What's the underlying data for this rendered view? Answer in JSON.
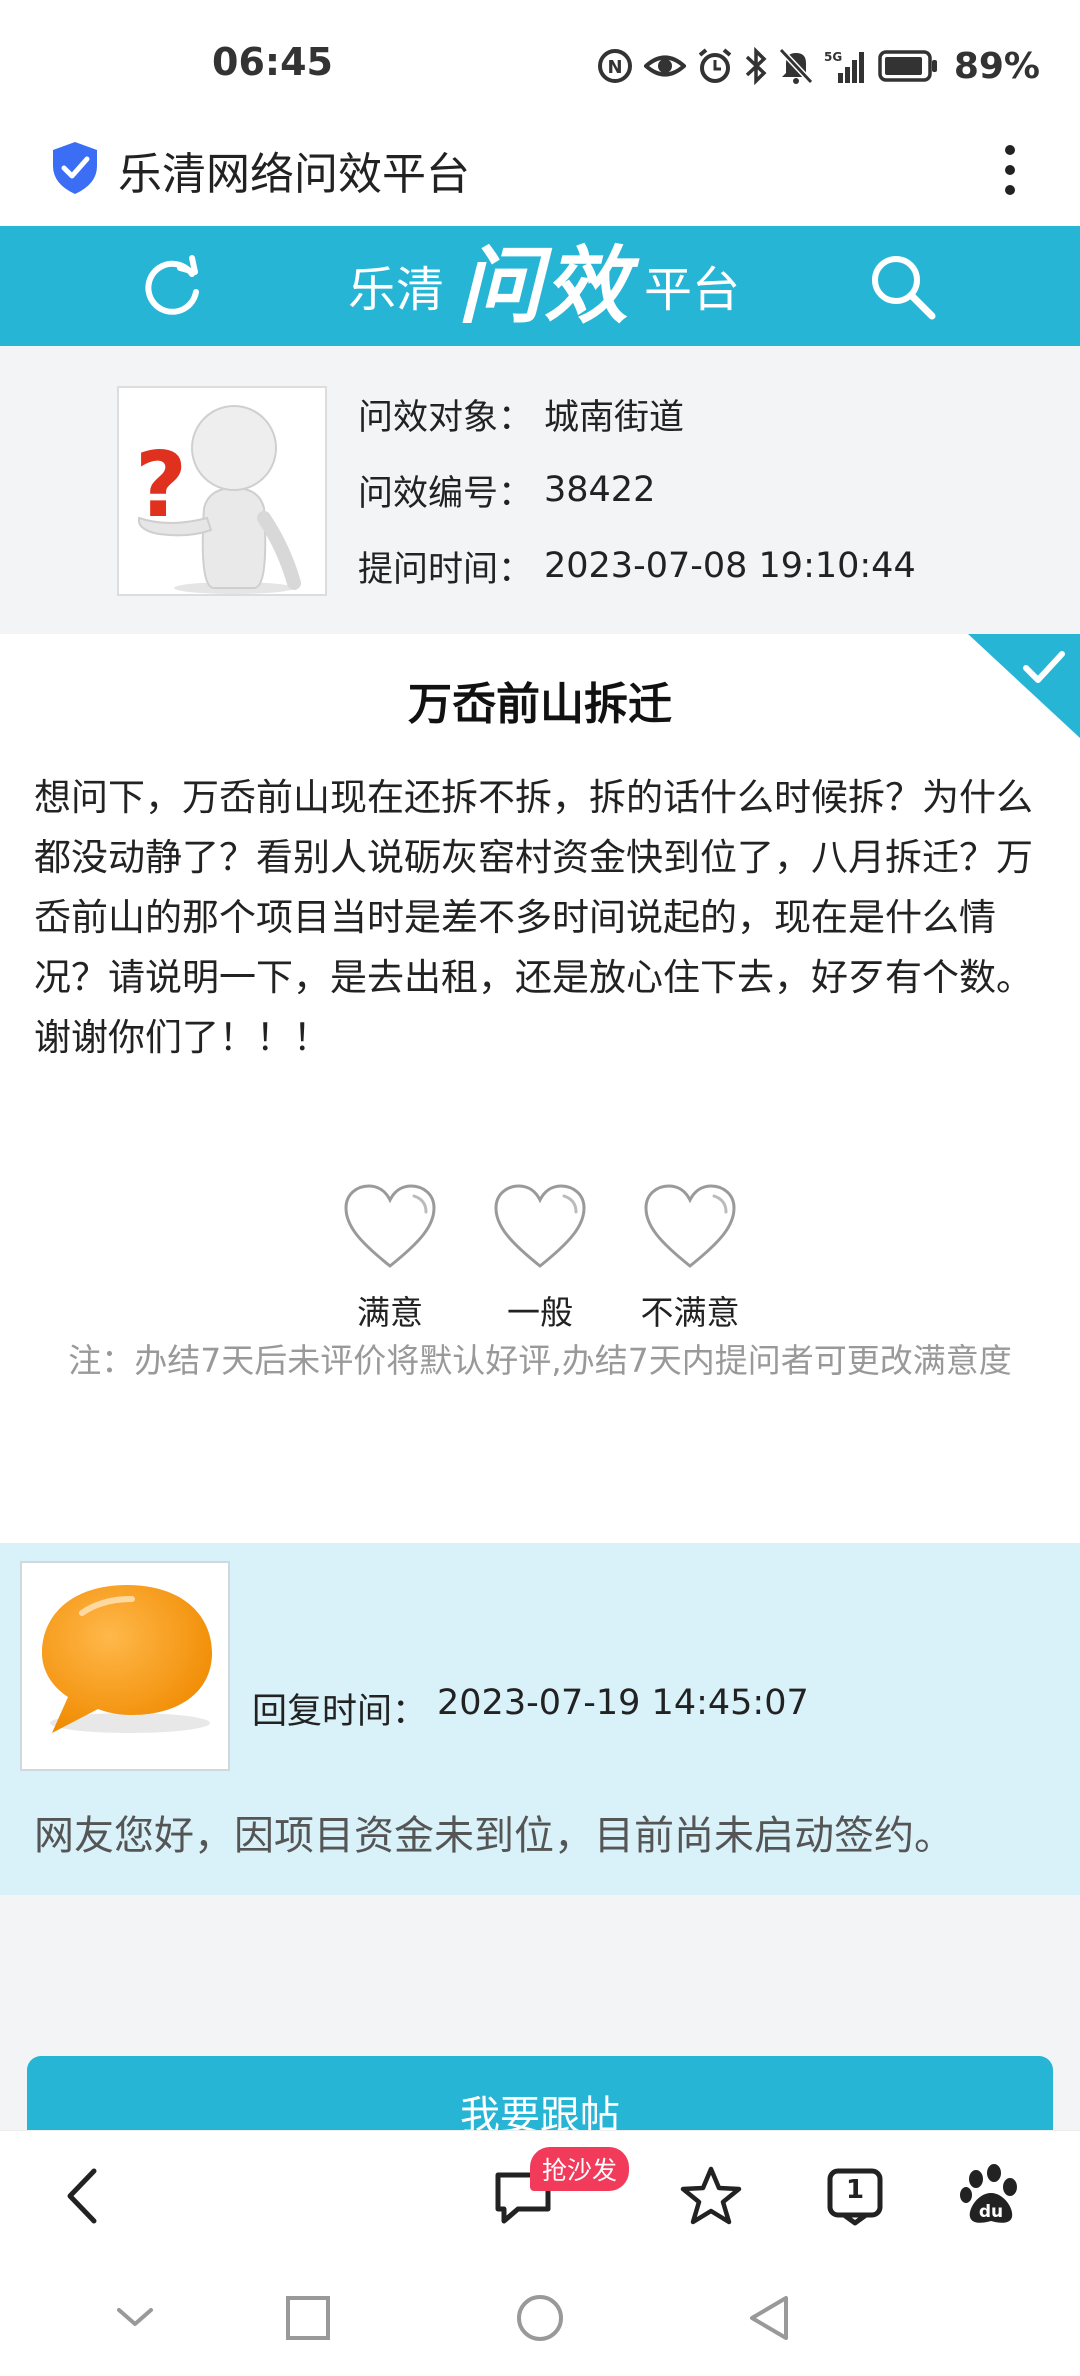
{
  "status_bar": {
    "time": "06:45",
    "battery": "89%",
    "icons": [
      "nfc-icon",
      "eye-icon",
      "alarm-icon",
      "bluetooth-icon",
      "mute-icon",
      "signal-5g-icon",
      "battery-icon"
    ]
  },
  "browser": {
    "title": "乐清网络问效平台",
    "icons": [
      "shield-icon",
      "more-icon"
    ]
  },
  "site_header": {
    "logo_prefix": "乐清",
    "logo_main": "问效",
    "logo_suffix": "平台",
    "icons": [
      "refresh-icon",
      "search-icon"
    ]
  },
  "info": {
    "rows": [
      {
        "label": "问效对象：",
        "value": "城南街道"
      },
      {
        "label": "问效编号：",
        "value": "38422"
      },
      {
        "label": "提问时间：",
        "value": "2023-07-08 19:10:44"
      }
    ]
  },
  "question": {
    "title": "万岙前山拆迁",
    "body": "想问下，万岙前山现在还拆不拆，拆的话什么时候拆？为什么都没动静了？看别人说砺灰窑村资金快到位了，八月拆迁？万岙前山的那个项目当时是差不多时间说起的，现在是什么情况？请说明一下，是去出租，还是放心住下去，好歹有个数。谢谢你们了！！！"
  },
  "rating": {
    "options": [
      {
        "label": "满意"
      },
      {
        "label": "一般"
      },
      {
        "label": "不满意"
      }
    ],
    "note": "注：办结7天后未评价将默认好评,办结7天内提问者可更改满意度"
  },
  "reply": {
    "time_label": "回复时间：",
    "time_value": "2023-07-19 14:45:07",
    "text": "网友您好，因项目资金未到位，目前尚未启动签约。"
  },
  "follow_button": "我要跟帖",
  "toolbar": {
    "sofa_badge": "抢沙发",
    "tabs_count": "1",
    "icons": [
      "back-icon",
      "comment-icon",
      "star-icon",
      "tabs-icon",
      "baidu-icon"
    ]
  },
  "colors": {
    "accent": "#27b5d6",
    "reply_bg": "#d9f2f9",
    "badge": "#f23a5a"
  }
}
